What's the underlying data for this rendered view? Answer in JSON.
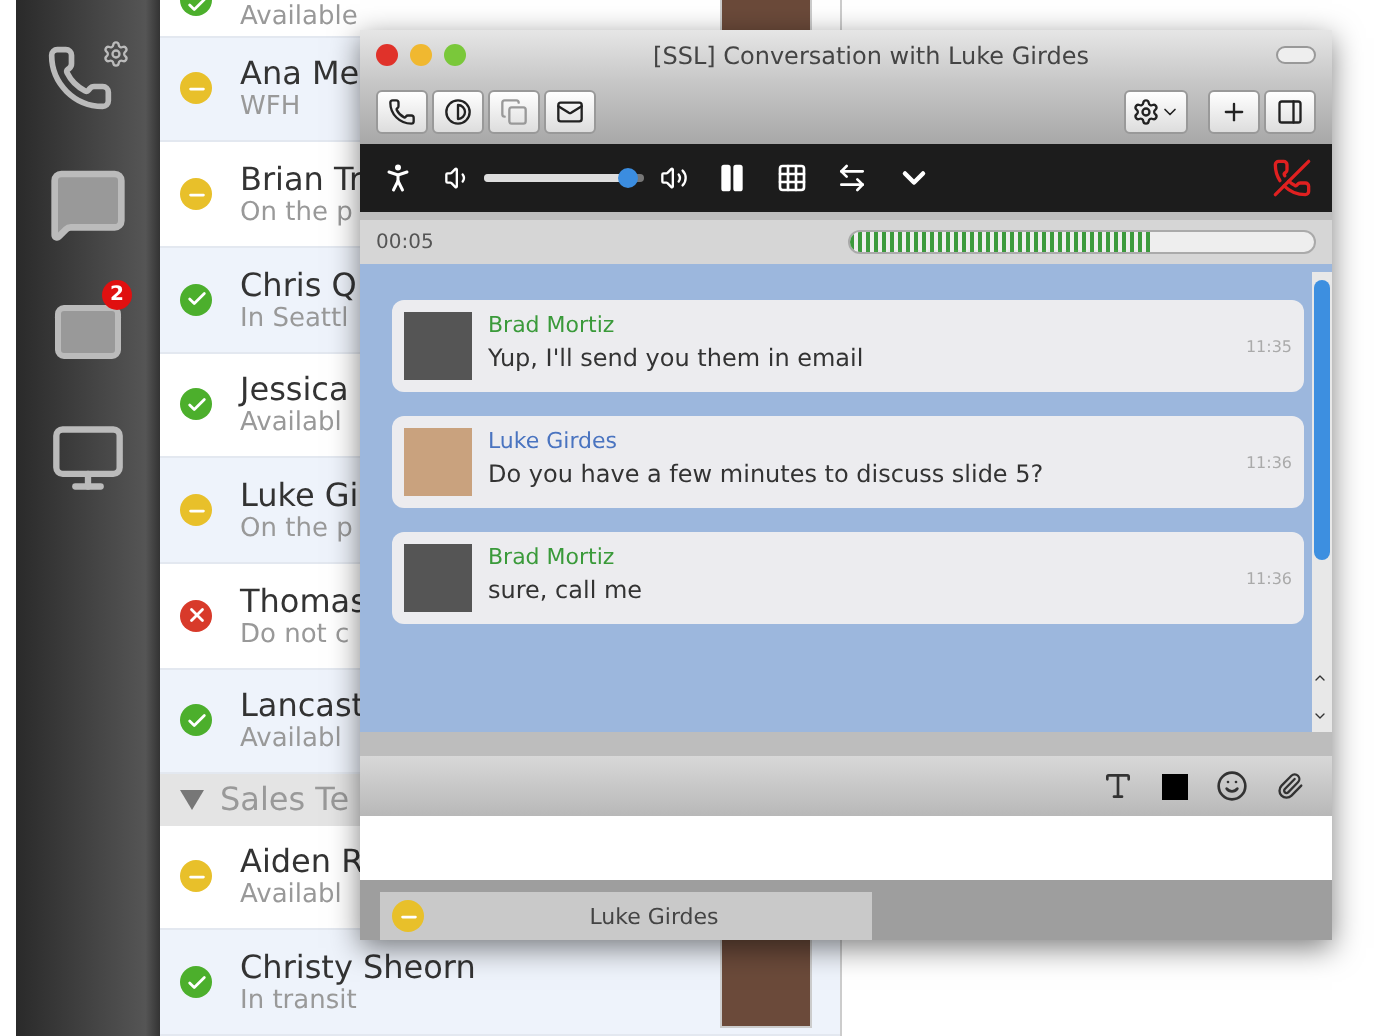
{
  "sidebar": {
    "mail_badge": "2"
  },
  "contacts": [
    {
      "kind": "contact",
      "status_text": "Available",
      "color": "#4caf2c",
      "photo": true
    },
    {
      "kind": "contact",
      "name": "Ana Me",
      "status_text": "WFH",
      "color": "#e8c02a",
      "photo": false
    },
    {
      "kind": "contact",
      "name": "Brian Tr",
      "status_text": "On the p",
      "color": "#e8c02a",
      "photo": false
    },
    {
      "kind": "contact",
      "name": "Chris Q",
      "status_text": "In Seattl",
      "color": "#4caf2c",
      "photo": false
    },
    {
      "kind": "contact",
      "name": "Jessica",
      "status_text": "Availabl",
      "color": "#4caf2c",
      "photo": false
    },
    {
      "kind": "contact",
      "name": "Luke Gi",
      "status_text": "On the p",
      "color": "#e8c02a",
      "photo": false
    },
    {
      "kind": "contact",
      "name": "Thomas",
      "status_text": "Do not c",
      "color": "#d83a2a",
      "photo": false
    },
    {
      "kind": "contact",
      "name": "Lancast",
      "status_text": "Availabl",
      "color": "#4caf2c",
      "photo": false
    },
    {
      "kind": "group",
      "name": "Sales Te",
      "expanded": true
    },
    {
      "kind": "contact",
      "name": "Aiden R",
      "status_text": "Availabl",
      "color": "#e8c02a",
      "photo": false
    },
    {
      "kind": "contact",
      "name": "Christy Sheorn",
      "status_text": "In transit",
      "color": "#4caf2c",
      "photo": true
    }
  ],
  "chat_window": {
    "title": "[SSL] Conversation with Luke Girdes",
    "call_time": "00:05",
    "volume": {
      "level": 0.9
    },
    "audio_meter": {
      "level": 0.65
    },
    "messages": [
      {
        "sender": "Brad Mortiz",
        "self": true,
        "text": "Yup, I'll send you them in email",
        "time": "11:35"
      },
      {
        "sender": "Luke Girdes",
        "self": false,
        "text": "Do you have a few minutes to discuss slide 5?",
        "time": "11:36"
      },
      {
        "sender": "Brad Mortiz",
        "self": true,
        "text": "sure, call me",
        "time": "11:36"
      }
    ],
    "tabs": [
      {
        "label": "Luke Girdes",
        "color": "#e8c02a",
        "selected": true
      }
    ]
  }
}
